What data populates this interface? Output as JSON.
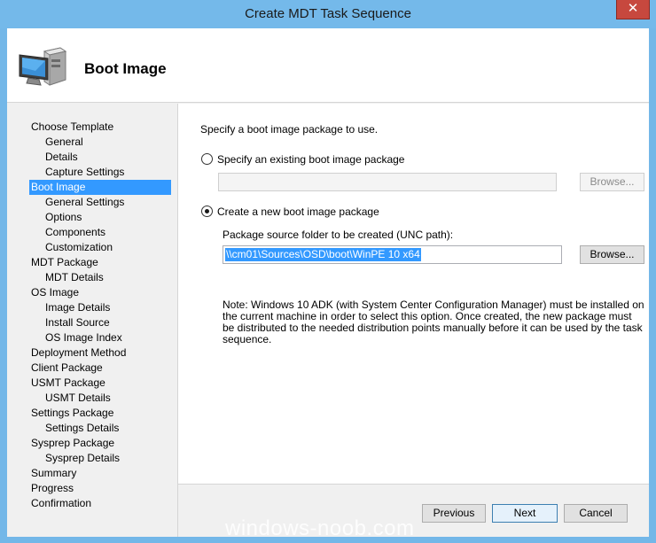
{
  "window": {
    "title": "Create MDT Task Sequence",
    "close_glyph": "✕"
  },
  "header": {
    "title": "Boot Image",
    "icon": "computer-icon"
  },
  "nav": {
    "items": [
      {
        "label": "Choose Template",
        "level": 0,
        "active": false
      },
      {
        "label": "General",
        "level": 1,
        "active": false
      },
      {
        "label": "Details",
        "level": 1,
        "active": false
      },
      {
        "label": "Capture Settings",
        "level": 1,
        "active": false
      },
      {
        "label": "Boot Image",
        "level": 0,
        "active": true
      },
      {
        "label": "General Settings",
        "level": 1,
        "active": false
      },
      {
        "label": "Options",
        "level": 1,
        "active": false
      },
      {
        "label": "Components",
        "level": 1,
        "active": false
      },
      {
        "label": "Customization",
        "level": 1,
        "active": false
      },
      {
        "label": "MDT Package",
        "level": 0,
        "active": false
      },
      {
        "label": "MDT Details",
        "level": 1,
        "active": false
      },
      {
        "label": "OS Image",
        "level": 0,
        "active": false
      },
      {
        "label": "Image Details",
        "level": 1,
        "active": false
      },
      {
        "label": "Install Source",
        "level": 1,
        "active": false
      },
      {
        "label": "OS Image Index",
        "level": 1,
        "active": false
      },
      {
        "label": "Deployment Method",
        "level": 0,
        "active": false
      },
      {
        "label": "Client Package",
        "level": 0,
        "active": false
      },
      {
        "label": "USMT Package",
        "level": 0,
        "active": false
      },
      {
        "label": "USMT Details",
        "level": 1,
        "active": false
      },
      {
        "label": "Settings Package",
        "level": 0,
        "active": false
      },
      {
        "label": "Settings Details",
        "level": 1,
        "active": false
      },
      {
        "label": "Sysprep Package",
        "level": 0,
        "active": false
      },
      {
        "label": "Sysprep Details",
        "level": 1,
        "active": false
      },
      {
        "label": "Summary",
        "level": 0,
        "active": false
      },
      {
        "label": "Progress",
        "level": 0,
        "active": false
      },
      {
        "label": "Confirmation",
        "level": 0,
        "active": false
      }
    ]
  },
  "content": {
    "instruction": "Specify a boot image package to use.",
    "option_existing": {
      "label": "Specify an existing boot image package",
      "selected": false,
      "value": "",
      "browse_label": "Browse..."
    },
    "option_new": {
      "label": "Create a new boot image package",
      "selected": true
    },
    "package_source_label": "Package source folder to be created (UNC path):",
    "package_source_value": "\\\\cm01\\Sources\\OSD\\boot\\WinPE 10 x64",
    "browse_label": "Browse...",
    "note": "Note: Windows 10 ADK (with System Center Configuration Manager) must be installed on the current machine in order to select this option.  Once created, the new package must be distributed to the needed distribution points manually before it can be used by the task sequence."
  },
  "footer": {
    "previous_label": "Previous",
    "next_label": "Next",
    "cancel_label": "Cancel"
  },
  "watermark": "windows-noob.com"
}
